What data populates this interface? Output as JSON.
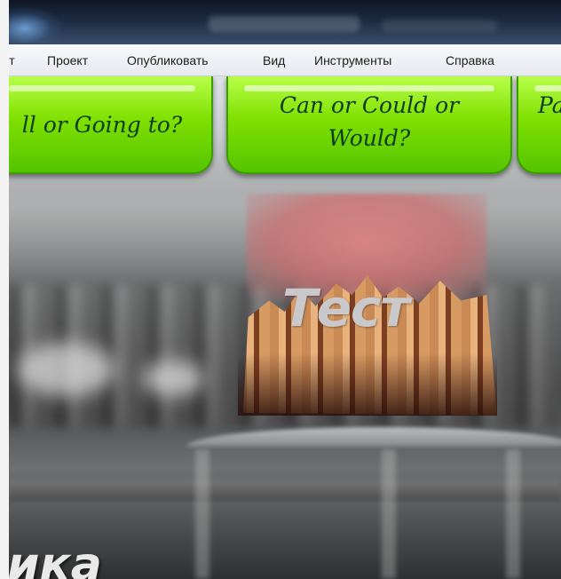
{
  "menu": {
    "items": [
      "кт",
      "Проект",
      "Опубликовать",
      "Вид",
      "Инструменты",
      "Справка"
    ]
  },
  "tabs": [
    {
      "label": "ll or Going to?"
    },
    {
      "label_line1": "Can or Could or",
      "label_line2": "Would?"
    },
    {
      "label": "Pa"
    }
  ],
  "center": {
    "title": "Тест"
  },
  "bottom": {
    "partial_title": "ика"
  },
  "colors": {
    "tab_green": "#7fe000",
    "tab_text": "#0e3d1e",
    "menu_bg": "#eef0f4"
  }
}
